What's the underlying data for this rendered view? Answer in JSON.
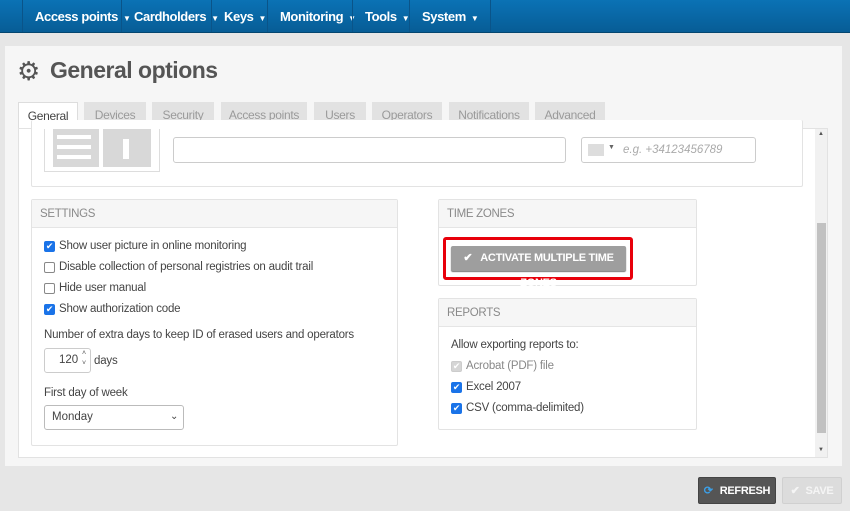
{
  "nav": {
    "items": [
      "Access points",
      "Cardholders",
      "Keys",
      "Monitoring",
      "Tools",
      "System"
    ]
  },
  "page": {
    "title": "General options",
    "icon": "gear-icon"
  },
  "tabs": [
    "General",
    "Devices",
    "Security",
    "Access points",
    "Users",
    "Operators",
    "Notifications",
    "Advanced"
  ],
  "contact": {
    "phone_placeholder": "e.g. +34123456789",
    "name_value": ""
  },
  "settings": {
    "header": "SETTINGS",
    "options": [
      {
        "label": "Show user picture in online monitoring",
        "checked": true
      },
      {
        "label": "Disable collection of personal registries on audit trail",
        "checked": false
      },
      {
        "label": "Hide user manual",
        "checked": false
      },
      {
        "label": "Show authorization code",
        "checked": true
      }
    ],
    "extra_days_label": "Number of extra days to keep ID of erased users and operators",
    "extra_days_value": "120",
    "days_unit": "days",
    "first_day_label": "First day of week",
    "first_day_value": "Monday"
  },
  "time_zones": {
    "header": "TIME ZONES",
    "button": "ACTIVATE MULTIPLE TIME ZONES",
    "highlight_color": "#e8000b"
  },
  "reports": {
    "header": "REPORTS",
    "label": "Allow exporting reports to:",
    "options": [
      {
        "label": "Acrobat (PDF) file",
        "checked": true,
        "disabled": true
      },
      {
        "label": "Excel 2007",
        "checked": true
      },
      {
        "label": "CSV (comma-delimited)",
        "checked": true
      }
    ]
  },
  "footer": {
    "refresh": "REFRESH",
    "save": "SAVE"
  }
}
